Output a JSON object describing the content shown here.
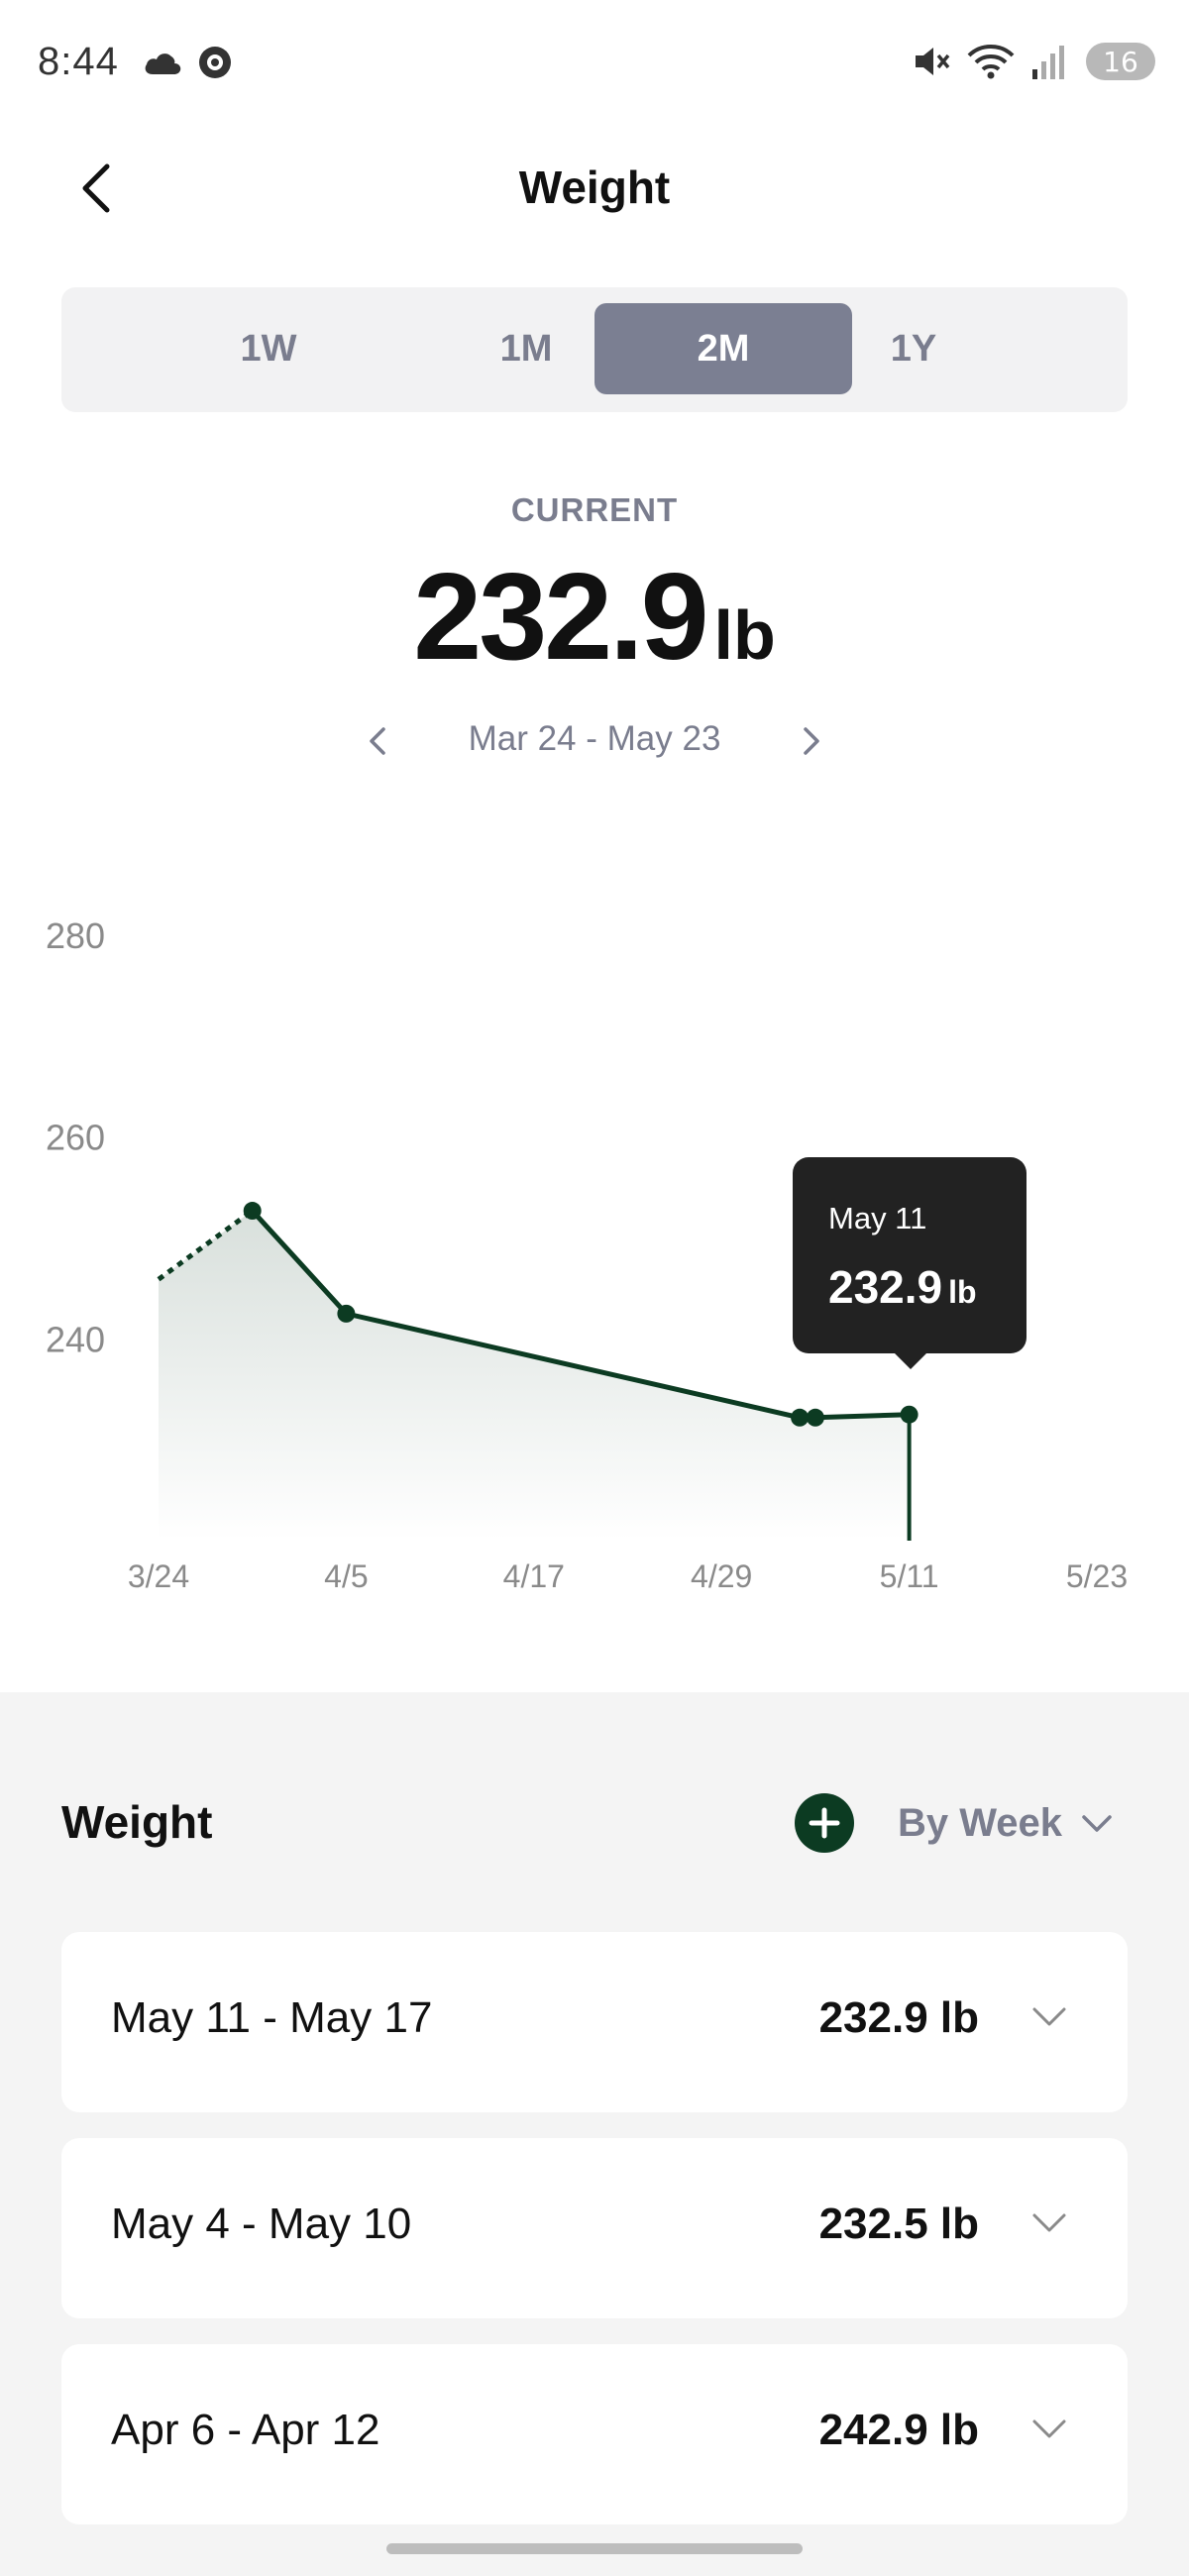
{
  "status_bar": {
    "time": "8:44",
    "battery": "16",
    "icons": [
      "cloud-icon",
      "record-icon",
      "mute-icon",
      "wifi-icon",
      "signal-icon",
      "battery-icon"
    ]
  },
  "header": {
    "title": "Weight",
    "back_icon": "chevron-left-icon"
  },
  "segmented": {
    "options": [
      "1W",
      "1M",
      "2M",
      "1Y"
    ],
    "selected": "2M"
  },
  "current": {
    "label": "CURRENT",
    "value": "232.9",
    "unit": "lb"
  },
  "range": {
    "label": "Mar 24 - May 23",
    "prev_icon": "chevron-left-icon",
    "next_icon": "chevron-right-icon"
  },
  "tooltip": {
    "date": "May 11",
    "value": "232.9",
    "unit": "lb"
  },
  "chart_data": {
    "type": "line",
    "x_ticks": [
      "3/24",
      "4/5",
      "4/17",
      "4/29",
      "5/11",
      "5/23"
    ],
    "y_ticks": [
      "280",
      "260",
      "240"
    ],
    "ylim": [
      220,
      280
    ],
    "projected_start": {
      "x": "3/24",
      "y": 245.9
    },
    "points": [
      {
        "x": "3/30",
        "y": 252.7
      },
      {
        "x": "4/5",
        "y": 242.5
      },
      {
        "x": "5/4",
        "y": 232.2
      },
      {
        "x": "5/5",
        "y": 232.2
      },
      {
        "x": "5/11",
        "y": 232.5
      }
    ],
    "selected_x": "5/11",
    "colors": {
      "line": "#0c3b22",
      "fill": "#0c3b22",
      "tick": "#8a8a8a"
    }
  },
  "list": {
    "title": "Weight",
    "add_icon": "plus-icon",
    "group_label": "By Week",
    "group_icon": "chevron-down-icon",
    "rows": [
      {
        "range": "May 11 - May 17",
        "value": "232.9 lb"
      },
      {
        "range": "May 4 - May 10",
        "value": "232.5 lb"
      },
      {
        "range": "Apr 6 - Apr 12",
        "value": "242.9 lb"
      }
    ]
  },
  "colors": {
    "accent": "#0c3b22",
    "segment_active": "#7b7f92",
    "muted_text": "#7a7d8e"
  }
}
